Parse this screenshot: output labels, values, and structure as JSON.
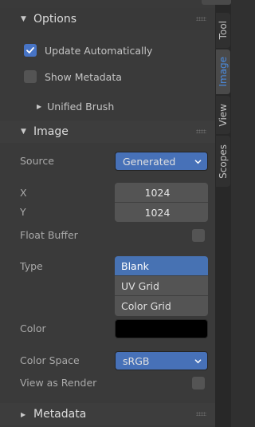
{
  "panel": {
    "options": {
      "title": "Options",
      "update_automatically": {
        "label": "Update Automatically",
        "checked": true
      },
      "show_metadata": {
        "label": "Show Metadata",
        "checked": false
      },
      "unified_brush": "Unified Brush"
    },
    "image": {
      "title": "Image",
      "source_label": "Source",
      "source_value": "Generated",
      "x_label": "X",
      "x_value": "1024",
      "y_label": "Y",
      "y_value": "1024",
      "float_buffer_label": "Float Buffer",
      "float_buffer_checked": false,
      "type_label": "Type",
      "type_options": [
        "Blank",
        "UV Grid",
        "Color Grid"
      ],
      "type_selected": "Blank",
      "color_label": "Color",
      "color_value": "#000000",
      "color_space_label": "Color Space",
      "color_space_value": "sRGB",
      "view_as_render_label": "View as Render",
      "view_as_render_checked": false
    },
    "metadata": {
      "title": "Metadata"
    }
  },
  "tabs": [
    "Tool",
    "Image",
    "View",
    "Scopes"
  ],
  "active_tab": "Image",
  "colors": {
    "accent": "#4772b3",
    "active_tab_text": "#4b8ce0"
  }
}
